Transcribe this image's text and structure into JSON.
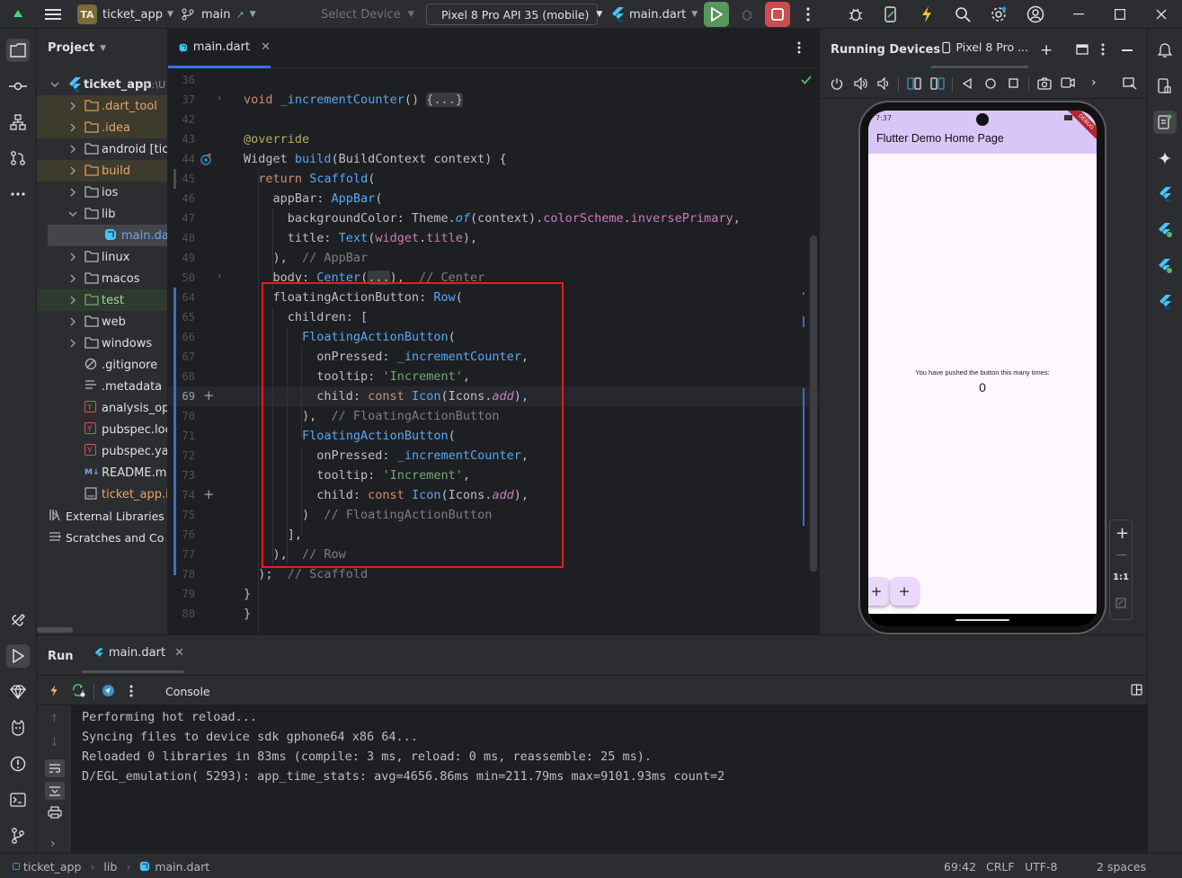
{
  "titlebar": {
    "project_badge": "TA",
    "project_name": "ticket_app",
    "branch": "main",
    "select_device": "Select Device",
    "device": "Pixel 8 Pro API 35 (mobile)",
    "run_config": "main.dart"
  },
  "project_panel": {
    "title": "Project",
    "root_name": "ticket_app",
    "root_path": "C:\\U",
    "items": [
      {
        "label": ".dart_tool",
        "kind": "folder-excluded",
        "indent": 1,
        "expandable": true
      },
      {
        "label": ".idea",
        "kind": "folder-excluded",
        "indent": 1,
        "expandable": true
      },
      {
        "label": "android [ticke",
        "kind": "folder",
        "indent": 1,
        "expandable": true
      },
      {
        "label": "build",
        "kind": "folder-excluded",
        "indent": 1,
        "expandable": true
      },
      {
        "label": "ios",
        "kind": "folder",
        "indent": 1,
        "expandable": true
      },
      {
        "label": "lib",
        "kind": "folder",
        "indent": 1,
        "expandable": true,
        "expanded": true
      },
      {
        "label": "main.dart",
        "kind": "dart",
        "indent": 2,
        "expandable": false,
        "selected": true
      },
      {
        "label": "linux",
        "kind": "folder",
        "indent": 1,
        "expandable": true
      },
      {
        "label": "macos",
        "kind": "folder",
        "indent": 1,
        "expandable": true
      },
      {
        "label": "test",
        "kind": "folder-test",
        "indent": 1,
        "expandable": true
      },
      {
        "label": "web",
        "kind": "folder",
        "indent": 1,
        "expandable": true
      },
      {
        "label": "windows",
        "kind": "folder",
        "indent": 1,
        "expandable": true
      },
      {
        "label": ".gitignore",
        "kind": "ignore",
        "indent": 1,
        "expandable": false
      },
      {
        "label": ".metadata",
        "kind": "text",
        "indent": 1,
        "expandable": false
      },
      {
        "label": "analysis_optio",
        "kind": "yaml",
        "indent": 1,
        "expandable": false
      },
      {
        "label": "pubspec.lock",
        "kind": "yaml",
        "indent": 1,
        "expandable": false
      },
      {
        "label": "pubspec.yaml",
        "kind": "yaml",
        "indent": 1,
        "expandable": false
      },
      {
        "label": "README.md",
        "kind": "md",
        "indent": 1,
        "expandable": false
      },
      {
        "label": "ticket_app.iml",
        "kind": "iml",
        "indent": 1,
        "expandable": false
      },
      {
        "label": "External Libraries",
        "kind": "libs",
        "indent": 0,
        "expandable": true
      },
      {
        "label": "Scratches and Co",
        "kind": "scratch",
        "indent": 0,
        "expandable": false
      }
    ]
  },
  "editor": {
    "tab_label": "main.dart",
    "lines": [
      {
        "n": "36",
        "html": ""
      },
      {
        "n": "37",
        "html": "<span class=\"kw\">void</span> <span class=\"fn\">_incrementCounter</span>() <span class=\"fold\">{...}</span>"
      },
      {
        "n": "42",
        "html": ""
      },
      {
        "n": "43",
        "html": "<span class=\"ann\">@override</span>"
      },
      {
        "n": "44",
        "html": "Widget <span class=\"fn\">build</span>(BuildContext context) {"
      },
      {
        "n": "45",
        "html": "  <span class=\"kw\">return</span> <span class=\"cls\">Scaffold</span>("
      },
      {
        "n": "46",
        "html": "    appBar: <span class=\"cls\">AppBar</span>("
      },
      {
        "n": "47",
        "html": "      backgroundColor: Theme.<span class=\"fn it\">of</span>(context).<span class=\"prop\">colorScheme</span>.<span class=\"prop\">inversePrimary</span>,"
      },
      {
        "n": "48",
        "html": "      title: <span class=\"cls\">Text</span>(<span class=\"prop\">widget</span>.<span class=\"prop\">title</span>),"
      },
      {
        "n": "49",
        "html": "    ),  <span class=\"cm\">// AppBar</span>"
      },
      {
        "n": "50",
        "html": "    body: <span class=\"cls\">Center</span>(<span class=\"fold\">...</span>),  <span class=\"cm\">// Center</span>"
      },
      {
        "n": "64",
        "html": "    floatingActionButton: <span class=\"cls\">Row</span>("
      },
      {
        "n": "65",
        "html": "      children: ["
      },
      {
        "n": "66",
        "html": "        <span class=\"cls\">FloatingActionButton</span>("
      },
      {
        "n": "67",
        "html": "          onPressed: <span class=\"fn\">_incrementCounter</span>,"
      },
      {
        "n": "68",
        "html": "          tooltip: <span class=\"str\">'Increment'</span>,"
      },
      {
        "n": "69",
        "html": "          child: <span class=\"kw\">const</span> <span class=\"cls\">Icon</span>(Icons.<span class=\"prop it\">add</span>),"
      },
      {
        "n": "70",
        "html": "        ),  <span class=\"cm\">// FloatingActionButton</span>"
      },
      {
        "n": "71",
        "html": "        <span class=\"cls\">FloatingActionButton</span>("
      },
      {
        "n": "72",
        "html": "          onPressed: <span class=\"fn\">_incrementCounter</span>,"
      },
      {
        "n": "73",
        "html": "          tooltip: <span class=\"str\">'Increment'</span>,"
      },
      {
        "n": "74",
        "html": "          child: <span class=\"kw\">const</span> <span class=\"cls\">Icon</span>(Icons.<span class=\"prop it\">add</span>),"
      },
      {
        "n": "75",
        "html": "        )  <span class=\"cm\">// FloatingActionButton</span>"
      },
      {
        "n": "76",
        "html": "      ],"
      },
      {
        "n": "77",
        "html": "    ),  <span class=\"cm\">// Row</span>"
      },
      {
        "n": "78",
        "html": "  );  <span class=\"cm\">// Scaffold</span>"
      },
      {
        "n": "79",
        "html": "}"
      },
      {
        "n": "80",
        "html": "}"
      }
    ]
  },
  "devices": {
    "title": "Running Devices",
    "tab_label": "Pixel 8 Pro ...",
    "app": {
      "status_time": "7:37",
      "appbar_title": "Flutter Demo Home Page",
      "debug_banner": "DEBUG",
      "message": "You have pushed the button this many times:",
      "counter": "0",
      "fab_icon": "+"
    },
    "zoom_label": "1:1"
  },
  "run": {
    "title": "Run",
    "tab_label": "main.dart",
    "console_tab": "Console",
    "lines": [
      "Performing hot reload...",
      "Syncing files to device sdk gphone64 x86 64...",
      "Reloaded 0 libraries in 83ms (compile: 3 ms, reload: 0 ms, reassemble: 25 ms).",
      "D/EGL_emulation( 5293): app_time_stats: avg=4656.86ms min=211.79ms max=9101.93ms count=2"
    ]
  },
  "statusbar": {
    "crumbs": [
      "ticket_app",
      "lib",
      "main.dart"
    ],
    "position": "69:42",
    "line_sep": "CRLF",
    "encoding": "UTF-8",
    "indent": "2 spaces"
  }
}
